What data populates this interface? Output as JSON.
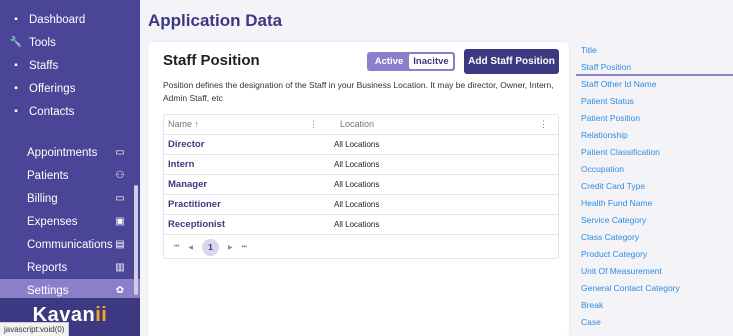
{
  "sidebar": {
    "top_items": [
      {
        "label": "Dashboard",
        "icon": "dashboard-icon",
        "glyph": "▪"
      },
      {
        "label": "Tools",
        "icon": "wrench-icon",
        "glyph": "🔧"
      },
      {
        "label": "Staffs",
        "icon": "staff-icon",
        "glyph": "▪"
      },
      {
        "label": "Offerings",
        "icon": "gift-icon",
        "glyph": "▪"
      },
      {
        "label": "Contacts",
        "icon": "contacts-icon",
        "glyph": "▪"
      }
    ],
    "sub_items": [
      {
        "label": "Appointments",
        "icon": "calendar-icon",
        "glyph": "▭"
      },
      {
        "label": "Patients",
        "icon": "people-icon",
        "glyph": "⚇"
      },
      {
        "label": "Billing",
        "icon": "card-icon",
        "glyph": "▭"
      },
      {
        "label": "Expenses",
        "icon": "expense-icon",
        "glyph": "▣"
      },
      {
        "label": "Communications",
        "icon": "chat-icon",
        "glyph": "▤"
      },
      {
        "label": "Reports",
        "icon": "report-icon",
        "glyph": "▥"
      },
      {
        "label": "Settings",
        "icon": "gear-icon",
        "glyph": "✿"
      }
    ],
    "logo_main": "Kavan",
    "logo_accent": "ii",
    "status_url": "javascript:void(0)"
  },
  "page": {
    "title": "Application Data"
  },
  "card": {
    "title": "Staff Position",
    "toggle_active": "Active",
    "toggle_inactive": "Inacitve",
    "add_button": "Add Staff Position",
    "description": "Position defines the designation of the Staff in your Business Location. It may be director, Owner, Intern, Admin Staff, etc",
    "table": {
      "col_name": "Name ↑",
      "col_location": "Location",
      "rows": [
        {
          "name": "Director",
          "location": "All Locations"
        },
        {
          "name": "Intern",
          "location": "All Locations"
        },
        {
          "name": "Manager",
          "location": "All Locations"
        },
        {
          "name": "Practitioner",
          "location": "All Locations"
        },
        {
          "name": "Receptionist",
          "location": "All Locations"
        }
      ],
      "current_page": "1"
    }
  },
  "right_panel": {
    "items": [
      "Title",
      "Staff Position",
      "Staff Other Id Name",
      "Patient Status",
      "Patient Position",
      "Relationship",
      "Patient Classification",
      "Occupation",
      "Credit Card Type",
      "Health Fund Name",
      "Service Category",
      "Class Category",
      "Product Category",
      "Unit Of Measurement",
      "General Contact Category",
      "Break",
      "Case"
    ],
    "active_index": 1
  },
  "colors": {
    "sidebar_bg": "#4a4596",
    "accent": "#3d3882",
    "link": "#2f8ce0",
    "logo_accent": "#f5a623"
  }
}
